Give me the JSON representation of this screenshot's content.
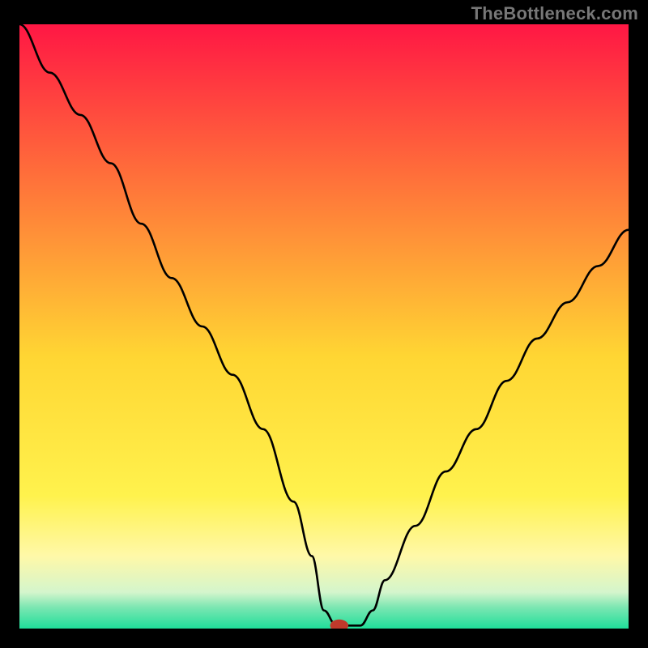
{
  "watermark": "TheBottleneck.com",
  "chart_data": {
    "type": "line",
    "title": "",
    "xlabel": "",
    "ylabel": "",
    "xlim": [
      0,
      100
    ],
    "ylim": [
      0,
      100
    ],
    "grid": false,
    "background_gradient": [
      {
        "stop": 0.0,
        "color": "#ff1744"
      },
      {
        "stop": 0.25,
        "color": "#ff6f3a"
      },
      {
        "stop": 0.55,
        "color": "#ffd633"
      },
      {
        "stop": 0.78,
        "color": "#fff24d"
      },
      {
        "stop": 0.88,
        "color": "#fff8a8"
      },
      {
        "stop": 0.94,
        "color": "#d4f5cc"
      },
      {
        "stop": 0.965,
        "color": "#7be6b2"
      },
      {
        "stop": 1.0,
        "color": "#1fdf9a"
      }
    ],
    "series": [
      {
        "name": "bottleneck-curve",
        "stroke": "#000000",
        "x": [
          0.0,
          5,
          10,
          15,
          20,
          25,
          30,
          35,
          40,
          45,
          48,
          50,
          52,
          53,
          56,
          58,
          60,
          65,
          70,
          75,
          80,
          85,
          90,
          95,
          100
        ],
        "y": [
          100,
          92,
          85,
          77,
          67,
          58,
          50,
          42,
          33,
          21,
          12,
          3,
          0.5,
          0.5,
          0.5,
          3,
          8,
          17,
          26,
          33,
          41,
          48,
          54,
          60,
          66
        ]
      }
    ],
    "minimum_marker": {
      "x": 52.5,
      "y": 0.5,
      "color": "#c0392b",
      "rx": 1.5,
      "ry": 1.0
    }
  }
}
